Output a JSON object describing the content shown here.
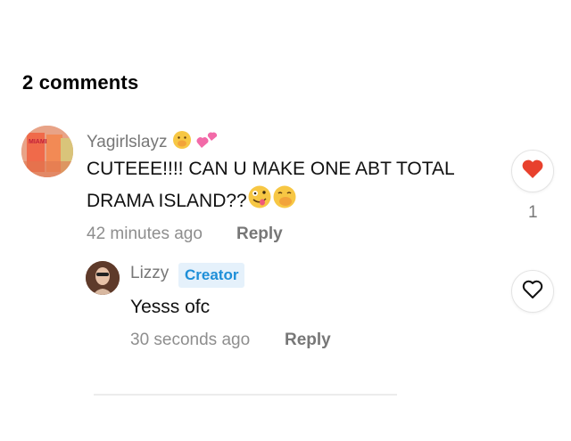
{
  "header": {
    "title": "2 comments"
  },
  "comment": {
    "username": "Yagirlslayz",
    "text_line1": "CUTEEE!!!! CAN U MAKE ONE ABT TOTAL",
    "text_line2": "DRAMA ISLAND??",
    "time": "42 minutes ago",
    "reply_label": "Reply",
    "like_count": "1",
    "liked": true,
    "avatar_text": "MIAMI"
  },
  "reply": {
    "username": "Lizzy",
    "badge": "Creator",
    "text": "Yesss ofc",
    "time": "30 seconds ago",
    "reply_label": "Reply",
    "liked": false
  },
  "colors": {
    "like_red": "#e8412d",
    "badge_blue": "#1e8fd8",
    "badge_bg": "#e5f1fb"
  },
  "icons": [
    "heart-filled-icon",
    "heart-outline-icon",
    "hand-over-mouth-emoji",
    "two-hearts-emoji",
    "zany-face-emoji"
  ]
}
